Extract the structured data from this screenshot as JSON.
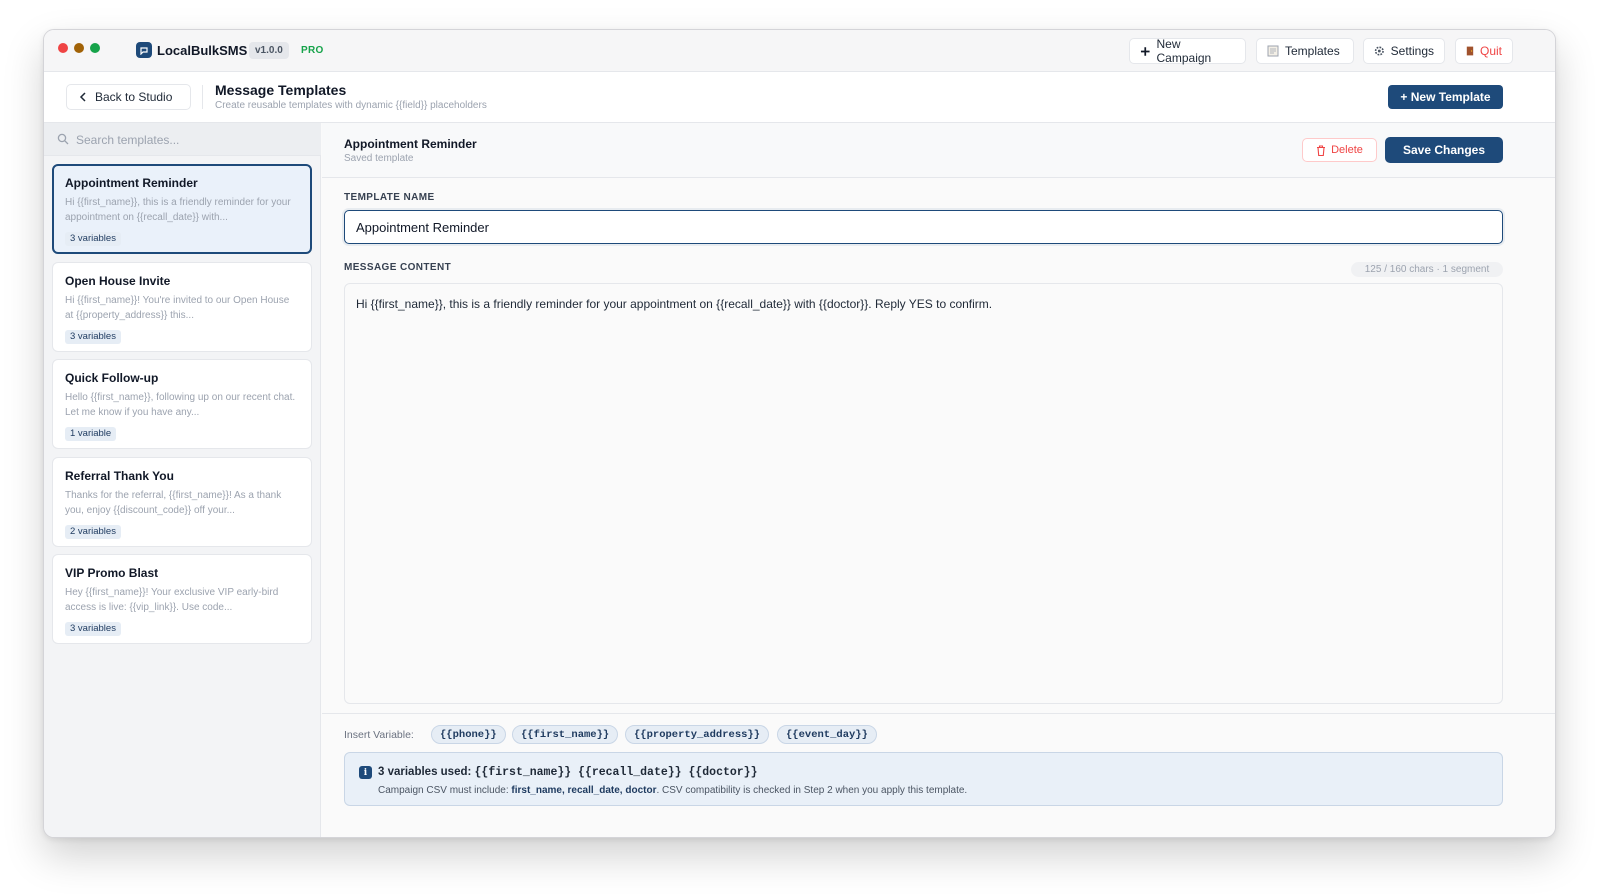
{
  "app": {
    "name": "LocalBulkSMS",
    "version": "v1.0.0",
    "tier": "PRO"
  },
  "toolbar": {
    "new_campaign": "New Campaign",
    "templates": "Templates",
    "settings": "Settings",
    "quit": "Quit"
  },
  "header": {
    "back_label": "Back to Studio",
    "title": "Message Templates",
    "subtitle": "Create reusable templates with dynamic {{field}} placeholders",
    "new_template": "+ New Template"
  },
  "sidebar": {
    "search_placeholder": "Search templates...",
    "templates": [
      {
        "name": "Appointment Reminder",
        "preview": "Hi {{first_name}}, this is a friendly reminder for your appointment on {{recall_date}} with...",
        "badge": "3 variables",
        "active": true
      },
      {
        "name": "Open House Invite",
        "preview": "Hi {{first_name}}! You're invited to our Open House at {{property_address}} this...",
        "badge": "3 variables",
        "active": false
      },
      {
        "name": "Quick Follow-up",
        "preview": "Hello {{first_name}}, following up on our recent chat. Let me know if you have any...",
        "badge": "1 variable",
        "active": false
      },
      {
        "name": "Referral Thank You",
        "preview": "Thanks for the referral, {{first_name}}! As a thank you, enjoy {{discount_code}} off your...",
        "badge": "2 variables",
        "active": false
      },
      {
        "name": "VIP Promo Blast",
        "preview": "Hey {{first_name}}! Your exclusive VIP early-bird access is live: {{vip_link}}. Use code...",
        "badge": "3 variables",
        "active": false
      }
    ]
  },
  "editor": {
    "title": "Appointment Reminder",
    "subtitle": "Saved template",
    "delete_label": "Delete",
    "save_label": "Save Changes",
    "name_label": "TEMPLATE NAME",
    "name_value": "Appointment Reminder",
    "content_label": "MESSAGE CONTENT",
    "char_count": "125 / 160 chars · 1 segment",
    "content_value": "Hi {{first_name}}, this is a friendly reminder for your appointment on {{recall_date}} with {{doctor}}. Reply YES to confirm.",
    "insert_label": "Insert Variable:",
    "variables": [
      "{{phone}}",
      "{{first_name}}",
      "{{property_address}}",
      "{{event_day}}"
    ],
    "info": {
      "count_text": "3 variables used:",
      "used_vars": "{{first_name}} {{recall_date}} {{doctor}}",
      "csv_prefix": "Campaign CSV must include:",
      "csv_fields": "first_name, recall_date, doctor",
      "csv_suffix": ". CSV compatibility is checked in Step 2 when you apply this template."
    }
  },
  "colors": {
    "accent": "#1e4a7a",
    "danger": "#ef4444",
    "pro": "#16a34a"
  }
}
